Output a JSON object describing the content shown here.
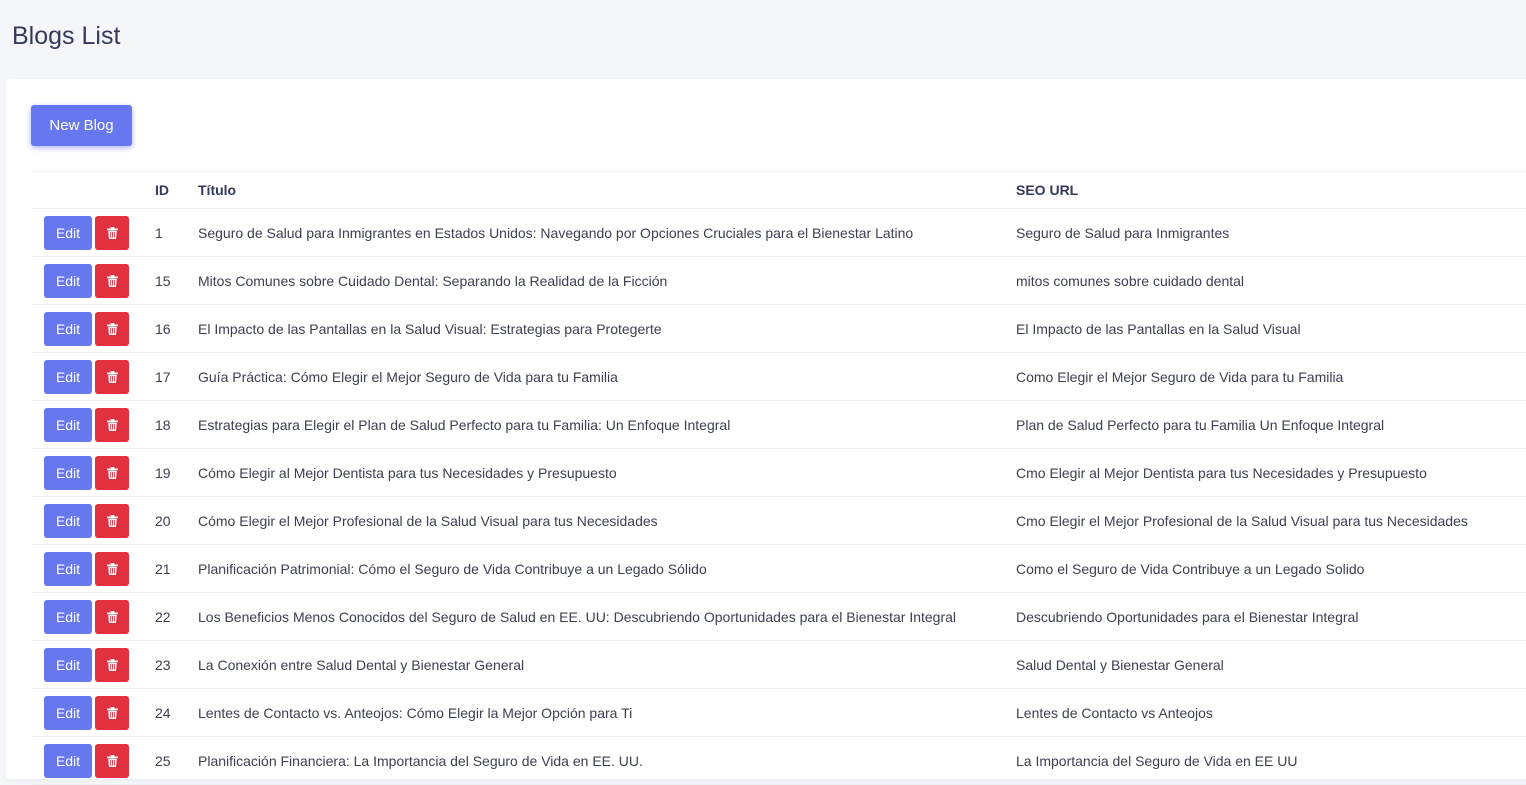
{
  "page": {
    "title": "Blogs List"
  },
  "toolbar": {
    "new_blog_label": "New Blog"
  },
  "table": {
    "headers": {
      "actions": "",
      "id": "ID",
      "title": "Título",
      "seo_url": "SEO URL"
    },
    "edit_label": "Edit",
    "delete_icon": "trash-icon",
    "rows": [
      {
        "id": "1",
        "title": "Seguro de Salud para Inmigrantes en Estados Unidos: Navegando por Opciones Cruciales para el Bienestar Latino",
        "seo_url": "Seguro de Salud para Inmigrantes"
      },
      {
        "id": "15",
        "title": "Mitos Comunes sobre Cuidado Dental: Separando la Realidad de la Ficción",
        "seo_url": "mitos comunes sobre cuidado dental"
      },
      {
        "id": "16",
        "title": "El Impacto de las Pantallas en la Salud Visual: Estrategias para Protegerte",
        "seo_url": "El Impacto de las Pantallas en la Salud Visual"
      },
      {
        "id": "17",
        "title": "Guía Práctica: Cómo Elegir el Mejor Seguro de Vida para tu Familia",
        "seo_url": "Como Elegir el Mejor Seguro de Vida para tu Familia"
      },
      {
        "id": "18",
        "title": "Estrategias para Elegir el Plan de Salud Perfecto para tu Familia: Un Enfoque Integral",
        "seo_url": "Plan de Salud Perfecto para tu Familia Un Enfoque Integral"
      },
      {
        "id": "19",
        "title": "Cómo Elegir al Mejor Dentista para tus Necesidades y Presupuesto",
        "seo_url": "Cmo Elegir al Mejor Dentista para tus Necesidades y Presupuesto"
      },
      {
        "id": "20",
        "title": "Cómo Elegir el Mejor Profesional de la Salud Visual para tus Necesidades",
        "seo_url": "Cmo Elegir el Mejor Profesional de la Salud Visual para tus Necesidades"
      },
      {
        "id": "21",
        "title": "Planificación Patrimonial: Cómo el Seguro de Vida Contribuye a un Legado Sólido",
        "seo_url": "Como el Seguro de Vida Contribuye a un Legado Solido"
      },
      {
        "id": "22",
        "title": "Los Beneficios Menos Conocidos del Seguro de Salud en EE. UU: Descubriendo Oportunidades para el Bienestar Integral",
        "seo_url": "Descubriendo Oportunidades para el Bienestar Integral"
      },
      {
        "id": "23",
        "title": "La Conexión entre Salud Dental y Bienestar General",
        "seo_url": "Salud Dental y Bienestar General"
      },
      {
        "id": "24",
        "title": "Lentes de Contacto vs. Anteojos: Cómo Elegir la Mejor Opción para Ti",
        "seo_url": "Lentes de Contacto vs Anteojos"
      },
      {
        "id": "25",
        "title": "Planificación Financiera: La Importancia del Seguro de Vida en EE. UU.",
        "seo_url": "La Importancia del Seguro de Vida en EE UU"
      }
    ]
  },
  "colors": {
    "primary": "#6777ef",
    "danger": "#e3303f",
    "background": "#f4f6f9",
    "card": "#ffffff"
  }
}
